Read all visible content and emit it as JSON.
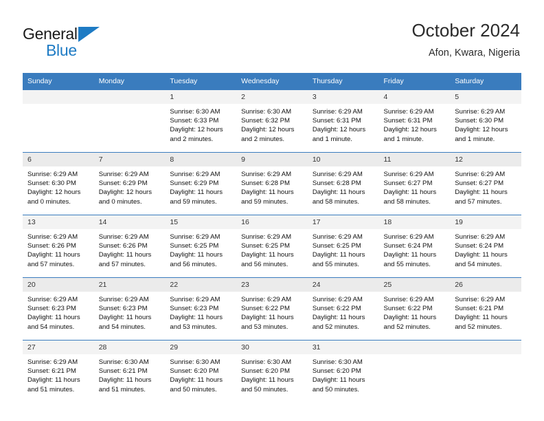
{
  "brand": {
    "name_top": "General",
    "name_bottom": "Blue",
    "accent_color": "#1e7bc4"
  },
  "header": {
    "title": "October 2024",
    "subtitle": "Afon, Kwara, Nigeria"
  },
  "calendar": {
    "header_bg": "#3a7cbe",
    "weekday_headers": [
      "Sunday",
      "Monday",
      "Tuesday",
      "Wednesday",
      "Thursday",
      "Friday",
      "Saturday"
    ],
    "weeks": [
      [
        {
          "day": "",
          "lines": []
        },
        {
          "day": "",
          "lines": []
        },
        {
          "day": "1",
          "lines": [
            "Sunrise: 6:30 AM",
            "Sunset: 6:33 PM",
            "Daylight: 12 hours",
            "and 2 minutes."
          ]
        },
        {
          "day": "2",
          "lines": [
            "Sunrise: 6:30 AM",
            "Sunset: 6:32 PM",
            "Daylight: 12 hours",
            "and 2 minutes."
          ]
        },
        {
          "day": "3",
          "lines": [
            "Sunrise: 6:29 AM",
            "Sunset: 6:31 PM",
            "Daylight: 12 hours",
            "and 1 minute."
          ]
        },
        {
          "day": "4",
          "lines": [
            "Sunrise: 6:29 AM",
            "Sunset: 6:31 PM",
            "Daylight: 12 hours",
            "and 1 minute."
          ]
        },
        {
          "day": "5",
          "lines": [
            "Sunrise: 6:29 AM",
            "Sunset: 6:30 PM",
            "Daylight: 12 hours",
            "and 1 minute."
          ]
        }
      ],
      [
        {
          "day": "6",
          "lines": [
            "Sunrise: 6:29 AM",
            "Sunset: 6:30 PM",
            "Daylight: 12 hours",
            "and 0 minutes."
          ]
        },
        {
          "day": "7",
          "lines": [
            "Sunrise: 6:29 AM",
            "Sunset: 6:29 PM",
            "Daylight: 12 hours",
            "and 0 minutes."
          ]
        },
        {
          "day": "8",
          "lines": [
            "Sunrise: 6:29 AM",
            "Sunset: 6:29 PM",
            "Daylight: 11 hours",
            "and 59 minutes."
          ]
        },
        {
          "day": "9",
          "lines": [
            "Sunrise: 6:29 AM",
            "Sunset: 6:28 PM",
            "Daylight: 11 hours",
            "and 59 minutes."
          ]
        },
        {
          "day": "10",
          "lines": [
            "Sunrise: 6:29 AM",
            "Sunset: 6:28 PM",
            "Daylight: 11 hours",
            "and 58 minutes."
          ]
        },
        {
          "day": "11",
          "lines": [
            "Sunrise: 6:29 AM",
            "Sunset: 6:27 PM",
            "Daylight: 11 hours",
            "and 58 minutes."
          ]
        },
        {
          "day": "12",
          "lines": [
            "Sunrise: 6:29 AM",
            "Sunset: 6:27 PM",
            "Daylight: 11 hours",
            "and 57 minutes."
          ]
        }
      ],
      [
        {
          "day": "13",
          "lines": [
            "Sunrise: 6:29 AM",
            "Sunset: 6:26 PM",
            "Daylight: 11 hours",
            "and 57 minutes."
          ]
        },
        {
          "day": "14",
          "lines": [
            "Sunrise: 6:29 AM",
            "Sunset: 6:26 PM",
            "Daylight: 11 hours",
            "and 57 minutes."
          ]
        },
        {
          "day": "15",
          "lines": [
            "Sunrise: 6:29 AM",
            "Sunset: 6:25 PM",
            "Daylight: 11 hours",
            "and 56 minutes."
          ]
        },
        {
          "day": "16",
          "lines": [
            "Sunrise: 6:29 AM",
            "Sunset: 6:25 PM",
            "Daylight: 11 hours",
            "and 56 minutes."
          ]
        },
        {
          "day": "17",
          "lines": [
            "Sunrise: 6:29 AM",
            "Sunset: 6:25 PM",
            "Daylight: 11 hours",
            "and 55 minutes."
          ]
        },
        {
          "day": "18",
          "lines": [
            "Sunrise: 6:29 AM",
            "Sunset: 6:24 PM",
            "Daylight: 11 hours",
            "and 55 minutes."
          ]
        },
        {
          "day": "19",
          "lines": [
            "Sunrise: 6:29 AM",
            "Sunset: 6:24 PM",
            "Daylight: 11 hours",
            "and 54 minutes."
          ]
        }
      ],
      [
        {
          "day": "20",
          "lines": [
            "Sunrise: 6:29 AM",
            "Sunset: 6:23 PM",
            "Daylight: 11 hours",
            "and 54 minutes."
          ]
        },
        {
          "day": "21",
          "lines": [
            "Sunrise: 6:29 AM",
            "Sunset: 6:23 PM",
            "Daylight: 11 hours",
            "and 54 minutes."
          ]
        },
        {
          "day": "22",
          "lines": [
            "Sunrise: 6:29 AM",
            "Sunset: 6:23 PM",
            "Daylight: 11 hours",
            "and 53 minutes."
          ]
        },
        {
          "day": "23",
          "lines": [
            "Sunrise: 6:29 AM",
            "Sunset: 6:22 PM",
            "Daylight: 11 hours",
            "and 53 minutes."
          ]
        },
        {
          "day": "24",
          "lines": [
            "Sunrise: 6:29 AM",
            "Sunset: 6:22 PM",
            "Daylight: 11 hours",
            "and 52 minutes."
          ]
        },
        {
          "day": "25",
          "lines": [
            "Sunrise: 6:29 AM",
            "Sunset: 6:22 PM",
            "Daylight: 11 hours",
            "and 52 minutes."
          ]
        },
        {
          "day": "26",
          "lines": [
            "Sunrise: 6:29 AM",
            "Sunset: 6:21 PM",
            "Daylight: 11 hours",
            "and 52 minutes."
          ]
        }
      ],
      [
        {
          "day": "27",
          "lines": [
            "Sunrise: 6:29 AM",
            "Sunset: 6:21 PM",
            "Daylight: 11 hours",
            "and 51 minutes."
          ]
        },
        {
          "day": "28",
          "lines": [
            "Sunrise: 6:30 AM",
            "Sunset: 6:21 PM",
            "Daylight: 11 hours",
            "and 51 minutes."
          ]
        },
        {
          "day": "29",
          "lines": [
            "Sunrise: 6:30 AM",
            "Sunset: 6:20 PM",
            "Daylight: 11 hours",
            "and 50 minutes."
          ]
        },
        {
          "day": "30",
          "lines": [
            "Sunrise: 6:30 AM",
            "Sunset: 6:20 PM",
            "Daylight: 11 hours",
            "and 50 minutes."
          ]
        },
        {
          "day": "31",
          "lines": [
            "Sunrise: 6:30 AM",
            "Sunset: 6:20 PM",
            "Daylight: 11 hours",
            "and 50 minutes."
          ]
        },
        {
          "day": "",
          "lines": []
        },
        {
          "day": "",
          "lines": []
        }
      ]
    ]
  }
}
